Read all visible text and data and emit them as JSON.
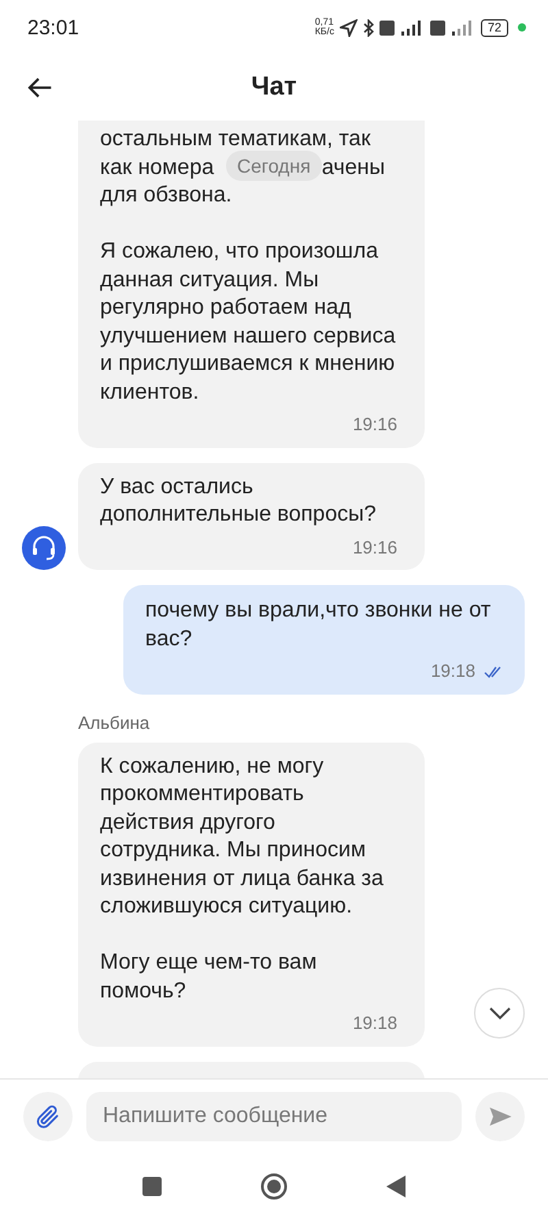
{
  "status_bar": {
    "time": "23:01",
    "speed_value": "0,71",
    "speed_unit": "КБ/с",
    "battery": "72"
  },
  "header": {
    "title": "Чат"
  },
  "date_chip": "Сегодня",
  "messages": [
    {
      "outgoing": false,
      "kind": "clipped",
      "avatar": false,
      "top_lines": [
        {
          "kind": "text",
          "text": "остальным тематикам, так"
        },
        {
          "kind": "split",
          "left": "как номера",
          "right": "ачены"
        },
        {
          "kind": "text",
          "text": "для обзвона."
        }
      ],
      "paragraphs": [
        "Я сожалею, что произошла данная ситуация. Мы регулярно работаем над улучшением нашего сервиса и прислушиваемся к мнению клиентов."
      ],
      "time": "19:16"
    },
    {
      "outgoing": false,
      "kind": "normal",
      "avatar": true,
      "paragraphs": [
        "У вас остались дополнительные вопросы?"
      ],
      "time": "19:16"
    },
    {
      "outgoing": true,
      "kind": "normal",
      "read": true,
      "paragraphs": [
        "почему вы врали,что звонки не от вас?"
      ],
      "time": "19:18"
    },
    {
      "outgoing": false,
      "kind": "normal",
      "avatar": false,
      "sender": "Альбина",
      "paragraphs": [
        "К сожалению, не могу прокомментировать действия другого сотрудника. Мы приносим извинения от лица банка за сложившуюся ситуацию.",
        "Могу еще чем-то вам помочь?"
      ],
      "time": "19:18"
    },
    {
      "outgoing": false,
      "kind": "stub",
      "avatar": false
    }
  ],
  "composer": {
    "placeholder": "Напишите сообщение"
  }
}
